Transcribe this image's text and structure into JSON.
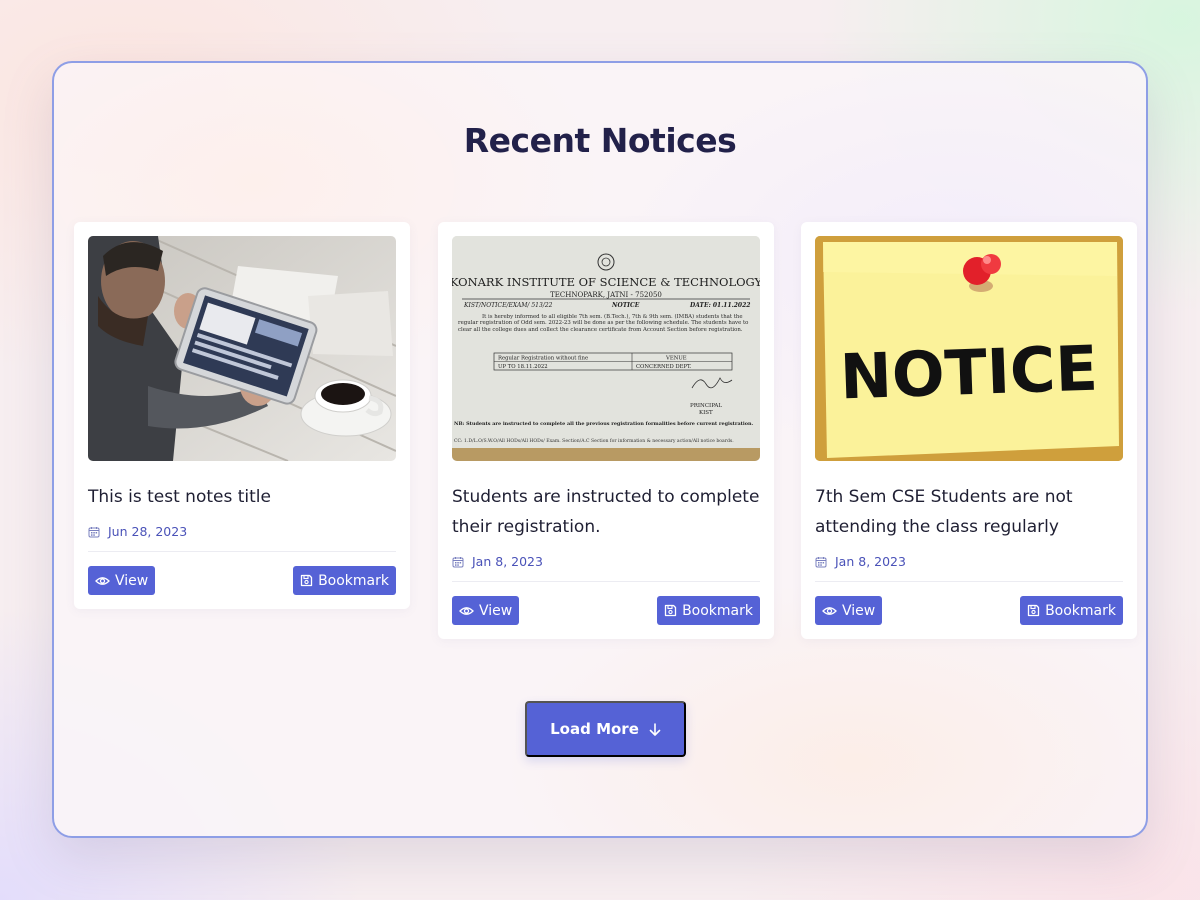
{
  "page": {
    "title": "Recent Notices",
    "load_more_label": "Load More",
    "accent": "#5562d6"
  },
  "cards": [
    {
      "title": "This is test notes title",
      "date": "Jun 28, 2023",
      "image": "photo-person-using-tablet",
      "view_label": "View",
      "bookmark_label": "Bookmark"
    },
    {
      "title": "Students are instructed to complete their registration.",
      "date": "Jan 8, 2023",
      "image": "scanned-notice-document",
      "view_label": "View",
      "bookmark_label": "Bookmark",
      "document": {
        "institute": "KONARK INSTITUTE OF SCIENCE & TECHNOLOGY",
        "address": "TECHNOPARK, JATNI - 752050",
        "ref": "KIST/NOTICE/EXAM/ 513/22",
        "label": "NOTICE",
        "date": "DATE: 01.11.2022",
        "body": "It is hereby informed to all eligible 7th sem. (B.Tech.), 7th & 9th sem. (IMBA) students that the regular registration of Odd sem. 2022-23 will be done as per the following schedule. The students have to clear all the college dues and collect the clearance certificate from Account Section before registration.",
        "table_h1": "Regular Registration without fine",
        "table_h2": "VENUE",
        "table_c1": "UP TO 18.11.2022",
        "table_c2": "CONCERNED DEPT.",
        "sign": "PRINCIPAL",
        "sign2": "KIST",
        "nb": "NB: Students are instructed to complete all the previous registration formalities before current registration.",
        "cc": "CC:     1.D/L.O/S.W.O/All HODs/All HODs/ Exam. Section/A.C Section for information & necessary action/All notice boards."
      }
    },
    {
      "title": "7th Sem CSE Students are not attending the class regularly",
      "date": "Jan 8, 2023",
      "image": "sticky-note-notice-pin",
      "view_label": "View",
      "bookmark_label": "Bookmark",
      "note_text": "NOTICE"
    }
  ],
  "icons": {
    "calendar": "calendar-icon",
    "view": "eye-icon",
    "bookmark": "save-icon",
    "load_more": "arrow-down-icon"
  }
}
